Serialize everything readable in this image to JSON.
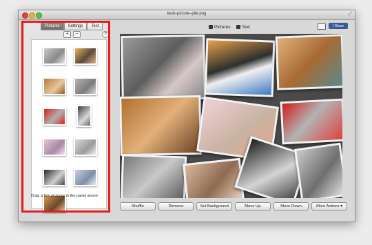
{
  "window": {
    "title": "kedi–picture–pile.png"
  },
  "toolbar": {
    "pictures_label": "Pictures",
    "text_label": "Text",
    "share_label": "f Share"
  },
  "sidebar": {
    "tabs": [
      "Pictures",
      "Settings",
      "Text"
    ],
    "add_label": "+",
    "remove_label": "−",
    "help_label": "?",
    "hint": "Drag a few pictures in the panel above"
  },
  "actions": {
    "shuffle": "Shuffle",
    "remove": "Remove",
    "set_background": "Set Background",
    "move_up": "Move Up",
    "move_down": "Move Down",
    "more_actions": "More Actions ▾"
  },
  "colors": {
    "highlight": "#e51c1c",
    "share": "#3b5998"
  }
}
